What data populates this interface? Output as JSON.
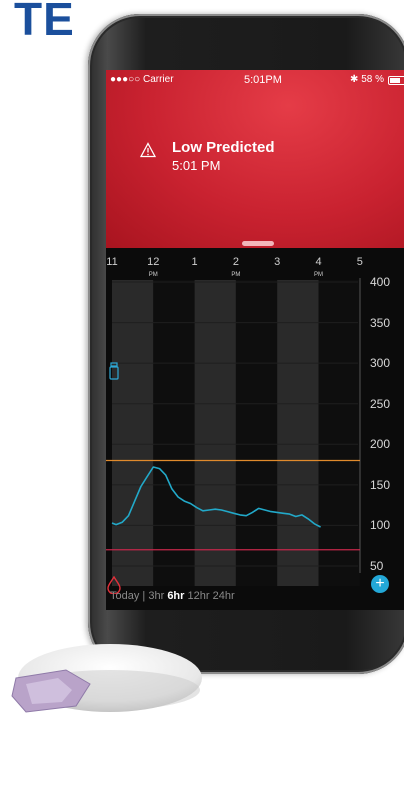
{
  "brand": {
    "text": "TE"
  },
  "status_bar": {
    "carrier": "●●●○○ Carrier",
    "time": "5:01PM",
    "battery": "58 %"
  },
  "alert": {
    "title": "Low Predicted",
    "time": "5:01 PM"
  },
  "time_axis": [
    {
      "label": "11",
      "sub": ""
    },
    {
      "label": "12",
      "sub": "PM"
    },
    {
      "label": "1",
      "sub": ""
    },
    {
      "label": "2",
      "sub": "PM"
    },
    {
      "label": "3",
      "sub": ""
    },
    {
      "label": "4",
      "sub": "PM"
    },
    {
      "label": "5",
      "sub": ""
    }
  ],
  "y_axis": [
    "400",
    "350",
    "300",
    "250",
    "200",
    "150",
    "100",
    "50"
  ],
  "range_selector": {
    "today": "Today",
    "separator": "|",
    "options": [
      "3hr",
      "6hr",
      "12hr",
      "24hr"
    ],
    "selected": "6hr"
  },
  "colors": {
    "high_line": "#e08a2c",
    "low_line": "#c4274a",
    "glucose_line": "#22a9c9",
    "alert_red": "#c92230",
    "brand_blue": "#1b4f9c"
  },
  "icons": {
    "warning": "warning-triangle-icon",
    "insulin": "insulin-vial-icon",
    "blood_drop": "blood-drop-icon",
    "carbs": "carbs-icon",
    "add": "plus-icon"
  },
  "chart_data": {
    "type": "line",
    "y_range": [
      40,
      400
    ],
    "high_threshold": 180,
    "low_threshold": 70,
    "series": [
      {
        "x": [
          0,
          0.1,
          0.25,
          0.4,
          0.55,
          0.7,
          0.85,
          1.0,
          1.15,
          1.3,
          1.45,
          1.6,
          1.75,
          1.9,
          2.05,
          2.2,
          2.35,
          2.5,
          2.65,
          2.8,
          2.95,
          3.1,
          3.25,
          3.4,
          3.55,
          3.7,
          3.85,
          4.0,
          4.15,
          4.3,
          4.45,
          4.6,
          4.75,
          4.9,
          5.05
        ],
        "y": [
          103,
          101,
          104,
          112,
          130,
          148,
          160,
          172,
          170,
          162,
          145,
          135,
          130,
          127,
          122,
          118,
          119,
          120,
          119,
          117,
          115,
          113,
          112,
          116,
          121,
          119,
          117,
          116,
          115,
          114,
          111,
          113,
          108,
          102,
          98
        ]
      }
    ]
  }
}
